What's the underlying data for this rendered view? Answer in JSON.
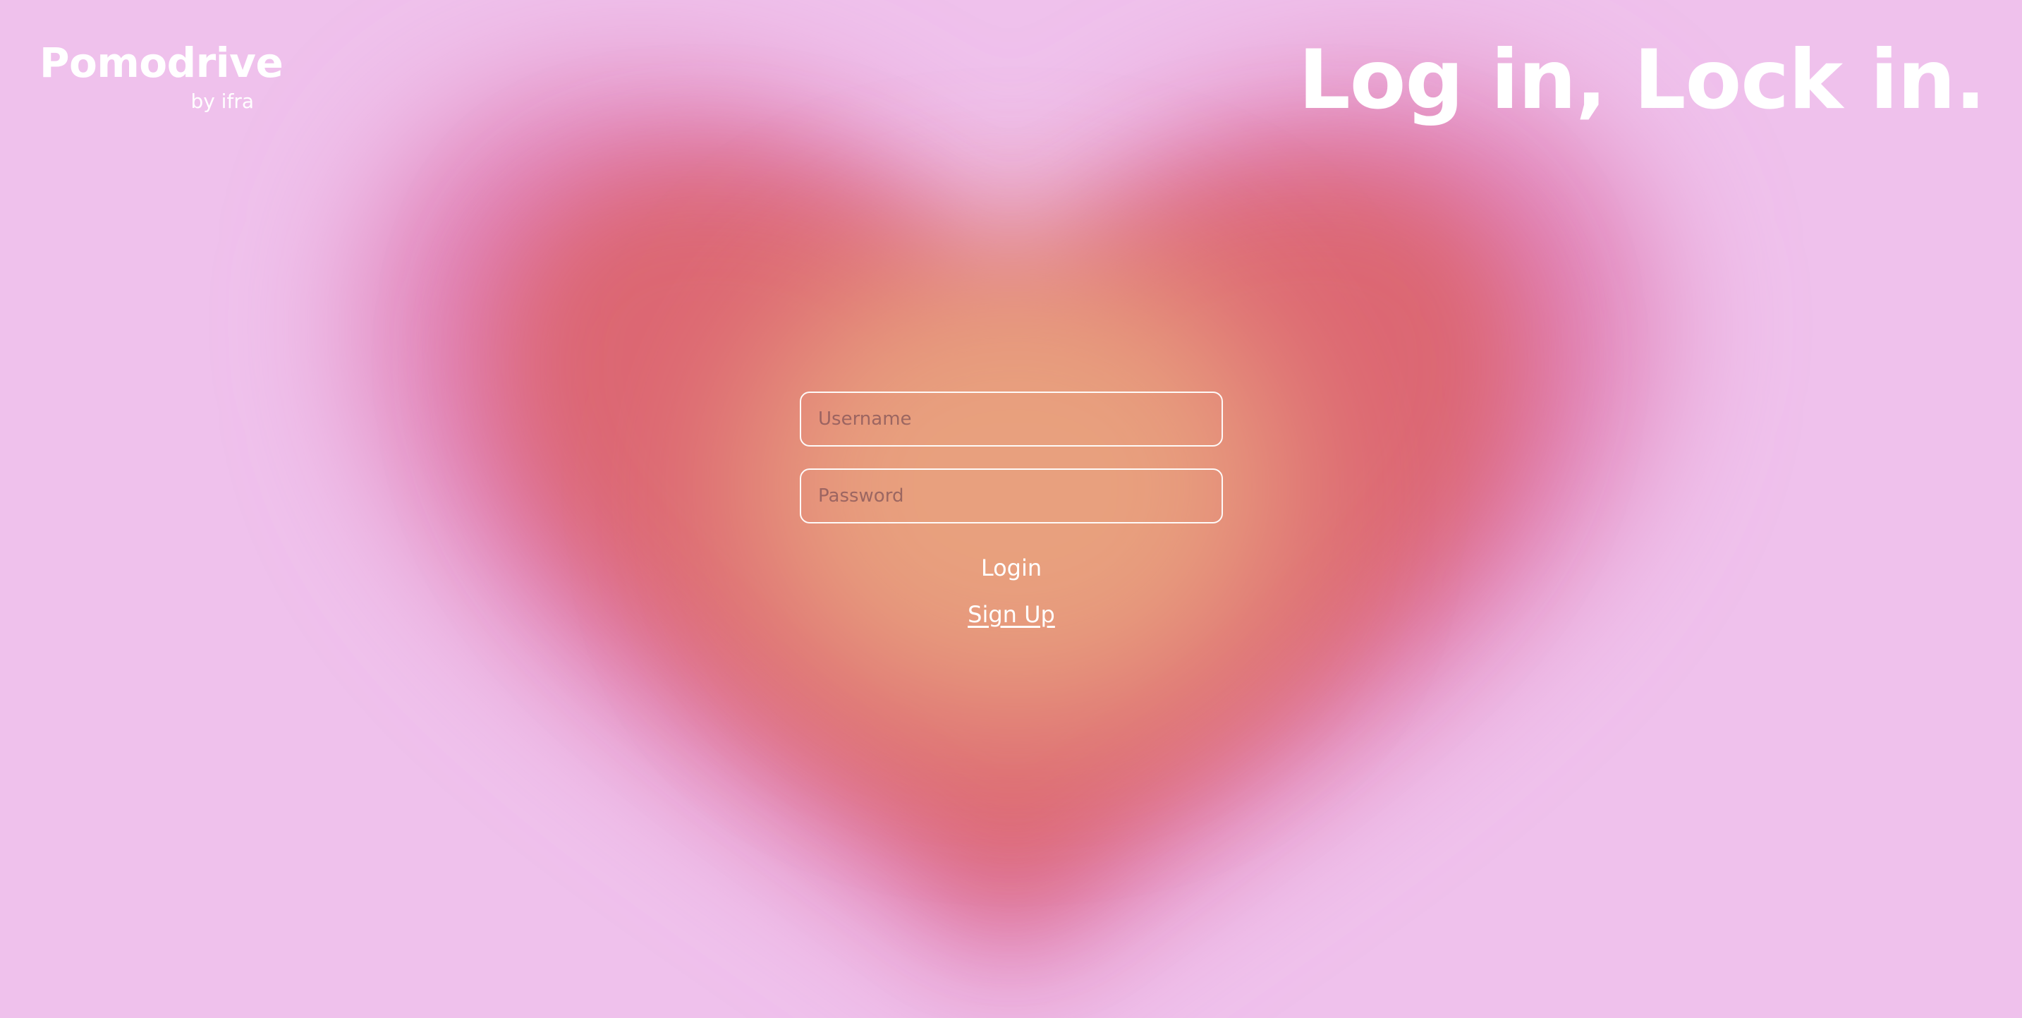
{
  "brand": {
    "name": "Pomodrive",
    "subtitle": "by ifra"
  },
  "header": {
    "tagline": "Log in, Lock in."
  },
  "login_form": {
    "username_placeholder": "Username",
    "username_value": "",
    "password_placeholder": "Password",
    "password_value": "",
    "login_label": "Login",
    "signup_label": "Sign Up"
  },
  "colors": {
    "background": "#efc1ec",
    "heart_outer": "#e07fb4",
    "heart_mid": "#dc6672",
    "heart_core": "#e49a7a",
    "text": "#ffffff"
  },
  "icons": {
    "background_art": "heart-gradient"
  }
}
